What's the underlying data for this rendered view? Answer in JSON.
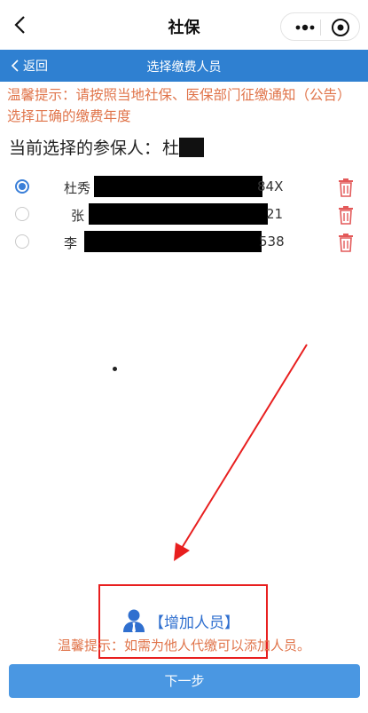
{
  "wechat": {
    "title": "社保",
    "icons": {
      "back": "chevron-left-icon",
      "more": "more-dots-icon",
      "close": "target-icon"
    }
  },
  "header": {
    "back_label": "返回",
    "title": "选择缴费人员"
  },
  "notice": "温馨提示：请按照当地社保、医保部门征缴通知（公告）选择正确的缴费年度",
  "current": {
    "label": "当前选择的参保人：",
    "name": "杜"
  },
  "persons": [
    {
      "name": "杜秀",
      "id_tail": "84X",
      "selected": true
    },
    {
      "name": "张",
      "id_tail": "21",
      "selected": false
    },
    {
      "name": "李",
      "id_tail": "538",
      "selected": false
    }
  ],
  "add": {
    "label": "【增加人员】",
    "icon": "person-icon"
  },
  "hint": "温馨提示：如需为他人代缴可以添加人员。",
  "next_button": "下一步",
  "colors": {
    "accent": "#2f80d1",
    "warning": "#e0744a",
    "delete": "#e35a5a",
    "annotation": "#e81f1f"
  }
}
